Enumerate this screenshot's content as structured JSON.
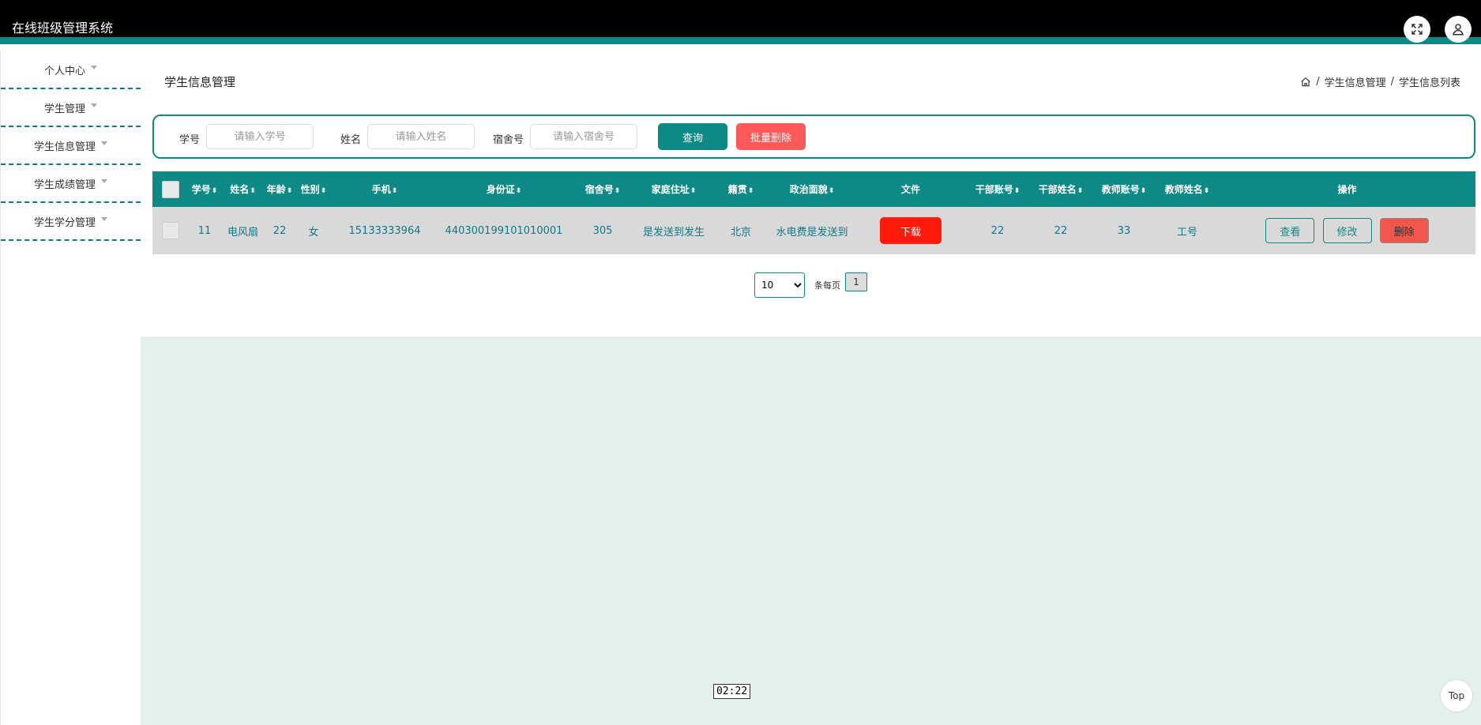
{
  "app": {
    "title": "在线班级管理系统"
  },
  "topbar": {
    "fullscreen_icon": "fullscreen-icon",
    "user_icon": "user-icon"
  },
  "sidebar": {
    "items": [
      {
        "label": "个人中心"
      },
      {
        "label": "学生管理"
      },
      {
        "label": "学生信息管理"
      },
      {
        "label": "学生成绩管理"
      },
      {
        "label": "学生学分管理"
      }
    ]
  },
  "page": {
    "title": "学生信息管理",
    "breadcrumb": {
      "home_icon": "home-icon",
      "sep": "/",
      "level1": "学生信息管理",
      "level2": "学生信息列表"
    }
  },
  "search": {
    "student_no_label": "学号",
    "student_no_placeholder": "请输入学号",
    "name_label": "姓名",
    "name_placeholder": "请输入姓名",
    "dorm_label": "宿舍号",
    "dorm_placeholder": "请输入宿舍号",
    "query_button": "查询",
    "batch_delete_button": "批量删除"
  },
  "table": {
    "columns": [
      "学号",
      "姓名",
      "年龄",
      "性别",
      "手机",
      "身份证",
      "宿舍号",
      "家庭住址",
      "籍贯",
      "政治面貌",
      "文件",
      "干部账号",
      "干部姓名",
      "教师账号",
      "教师姓名",
      "操作"
    ],
    "sortable": [
      "学号",
      "姓名",
      "年龄",
      "性别",
      "手机",
      "身份证",
      "宿舍号",
      "家庭住址",
      "籍贯",
      "政治面貌",
      "干部账号",
      "干部姓名",
      "教师账号",
      "教师姓名"
    ],
    "rows": [
      {
        "student_no": "11",
        "name": "电风扇",
        "age": "22",
        "gender": "女",
        "phone": "15133333964",
        "id_card": "440300199101010001",
        "dorm": "305",
        "address": "是发送到发生",
        "native": "北京",
        "political": "水电费是发送到",
        "file_button": "下载",
        "cadre_account": "22",
        "cadre_name": "22",
        "teacher_account": "33",
        "teacher_name": "工号",
        "view_button": "查看",
        "edit_button": "修改",
        "delete_button": "删除"
      }
    ]
  },
  "pagination": {
    "page_size": "10",
    "per_page_label": "条每页",
    "current_page": "1"
  },
  "overlay": {
    "timestamp": "02:22",
    "top_button": "Top"
  }
}
